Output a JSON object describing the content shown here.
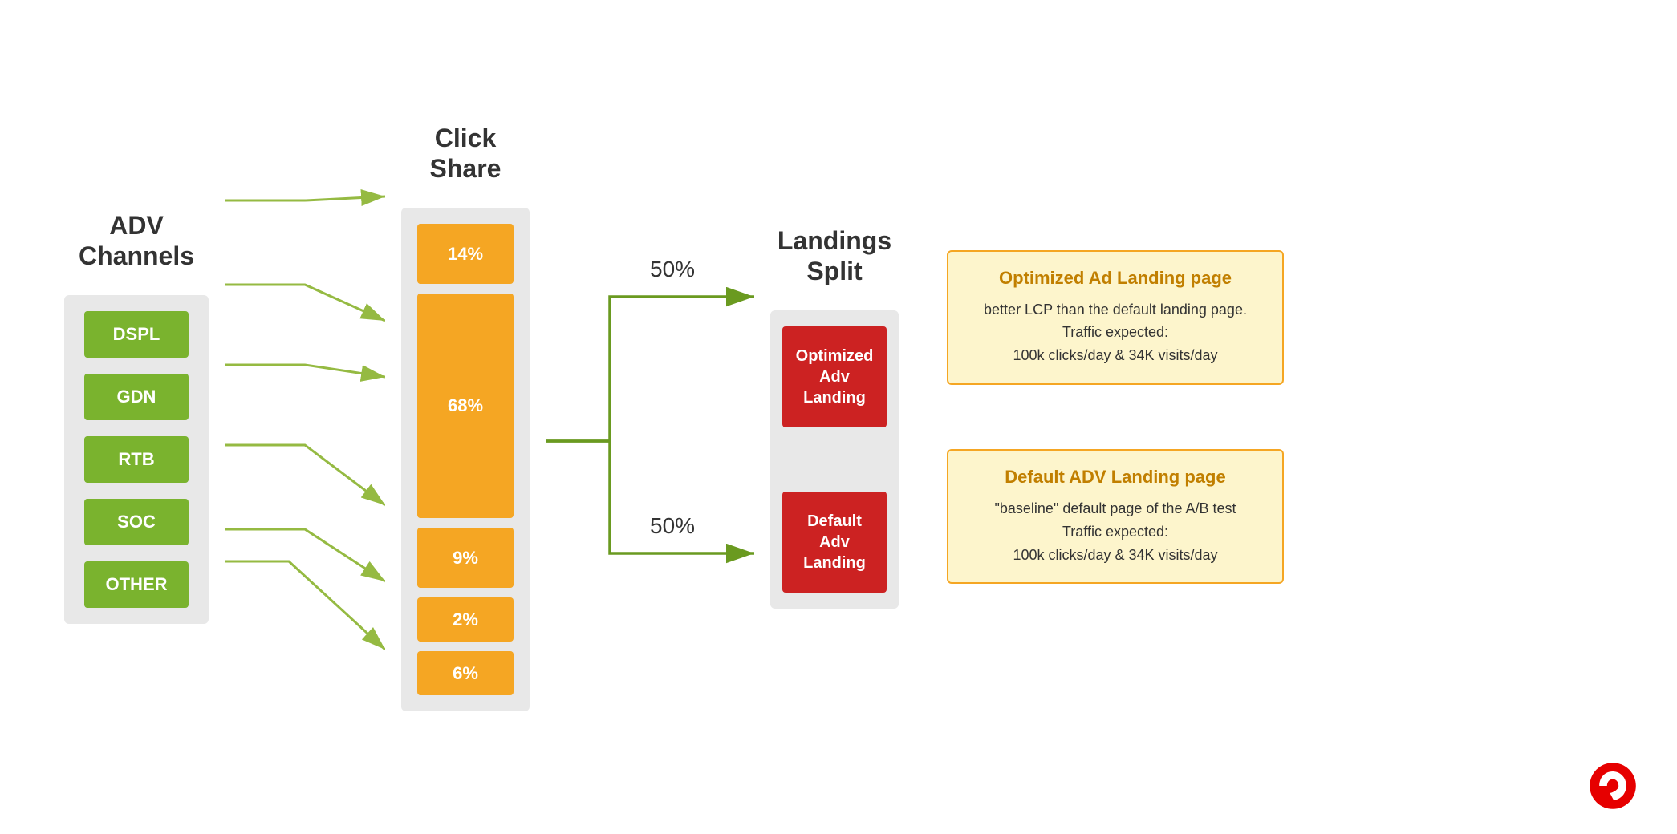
{
  "columns": {
    "adv": {
      "header": "ADV\nChannels",
      "channels": [
        {
          "label": "DSPL"
        },
        {
          "label": "GDN"
        },
        {
          "label": "RTB"
        },
        {
          "label": "SOC"
        },
        {
          "label": "OTHER"
        }
      ]
    },
    "click": {
      "header": "Click\nShare",
      "shares": [
        {
          "value": "14%",
          "size": "small"
        },
        {
          "value": "68%",
          "size": "large"
        },
        {
          "value": "9%",
          "size": "small"
        },
        {
          "value": "2%",
          "size": "xs"
        },
        {
          "value": "6%",
          "size": "xs"
        }
      ]
    },
    "landings": {
      "header": "Landings\nSplit",
      "split_labels": [
        "50%",
        "50%"
      ],
      "pages": [
        {
          "label": "Optimized\nAdv\nLanding"
        },
        {
          "label": "Default\nAdv\nLanding"
        }
      ]
    }
  },
  "info_cards": [
    {
      "title": "Optimized Ad Landing page",
      "body": "better LCP than the default landing page.\nTraffic expected:\n100k clicks/day  & 34K visits/day"
    },
    {
      "title": "Default ADV Landing page",
      "body": "\"baseline\" default page of the A/B test\nTraffic expected:\n100k clicks/day  & 34K visits/day"
    }
  ],
  "colors": {
    "green": "#7ab32e",
    "orange": "#f5a623",
    "red": "#cc2222",
    "bg_gray": "#e8e8e8",
    "info_bg": "#fdf5cc",
    "info_border": "#f5a623",
    "arrow_green": "#8ab32e"
  }
}
